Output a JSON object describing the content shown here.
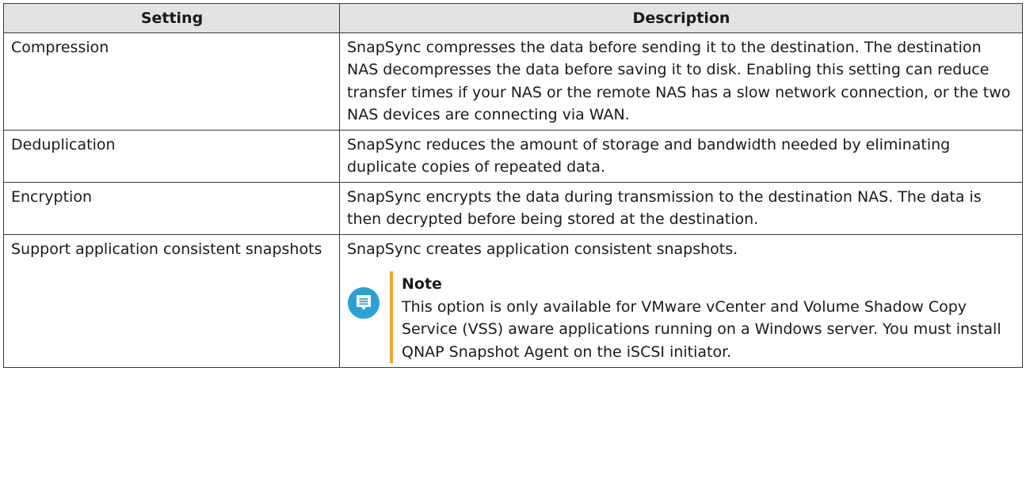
{
  "table": {
    "headers": {
      "setting": "Setting",
      "description": "Description"
    },
    "rows": [
      {
        "setting": "Compression",
        "description": "SnapSync compresses the data before sending it to the destination. The destination NAS decompresses the data before saving it to disk. Enabling this setting can reduce transfer times if your NAS or the remote NAS has a slow network connection, or the two NAS devices are connecting via WAN."
      },
      {
        "setting": "Deduplication",
        "description": "SnapSync reduces the amount of storage and bandwidth needed by eliminating duplicate copies of repeated data."
      },
      {
        "setting": "Encryption",
        "description": "SnapSync encrypts the data during transmission to the destination NAS. The data is then decrypted before being stored at the destination."
      },
      {
        "setting": "Support application consistent snapshots",
        "description": "SnapSync creates application consistent snapshots.",
        "note": {
          "title": "Note",
          "text": "This option is only available for VMware vCenter and Volume Shadow Copy Service (VSS) aware applications running on a Windows server. You must install QNAP Snapshot Agent on the iSCSI initiator.",
          "icon": "note-icon"
        }
      }
    ]
  },
  "colors": {
    "header_bg": "#e3e3e3",
    "note_icon": "#2aa0d8",
    "note_bar": "#f2a531",
    "border": "#3a3a3a"
  }
}
